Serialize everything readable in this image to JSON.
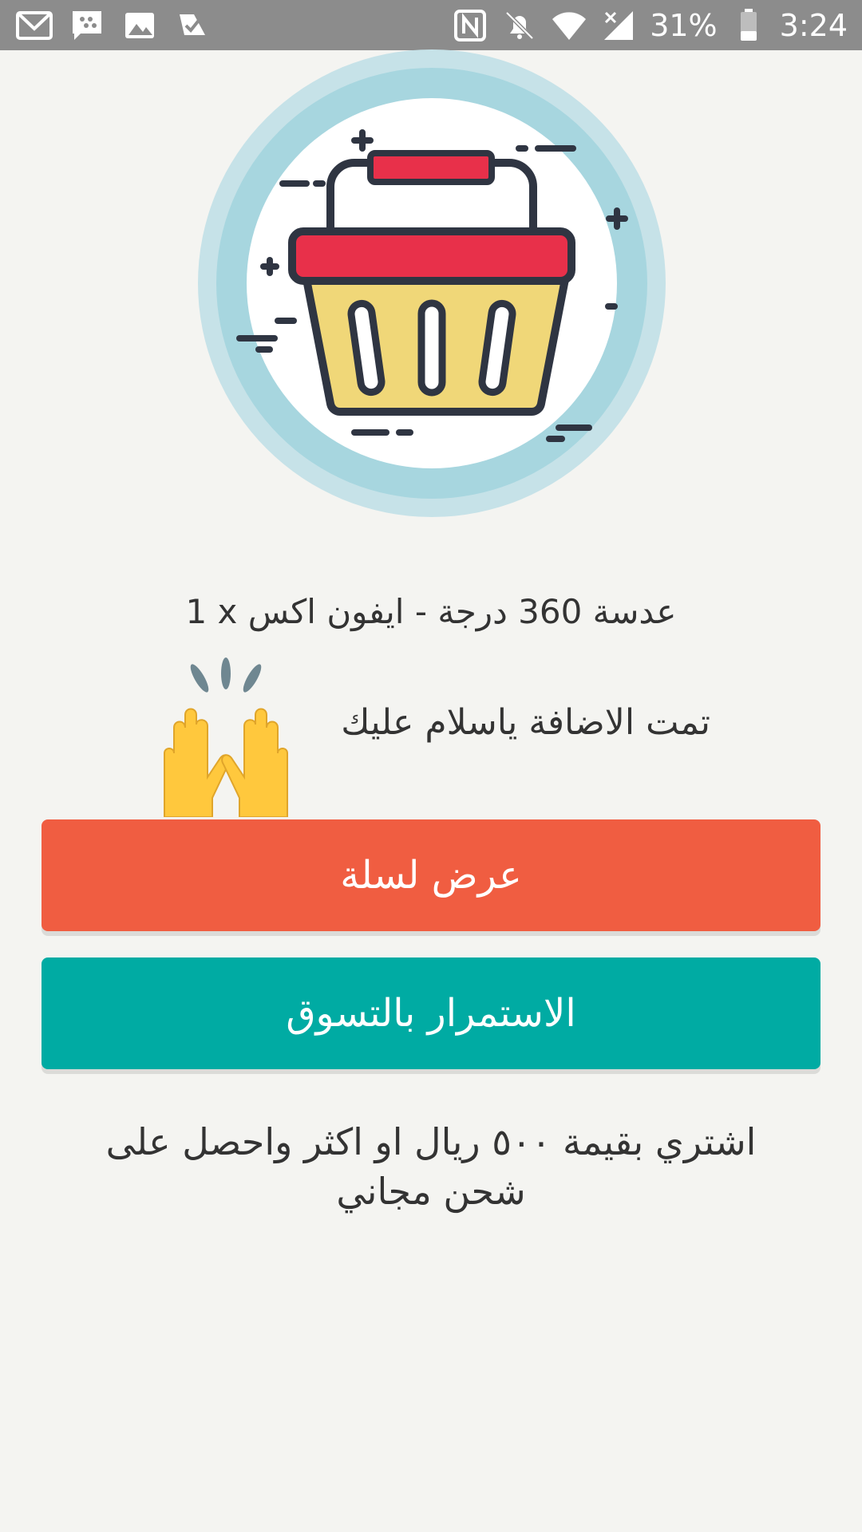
{
  "status_bar": {
    "battery": "31%",
    "time": "3:24",
    "left_icons": [
      "gmail-icon",
      "bbm-icon",
      "image-icon",
      "task-check-icon"
    ],
    "right_icons": [
      "nfc-icon",
      "bell-off-icon",
      "wifi-icon",
      "signal-off-icon",
      "battery-icon"
    ]
  },
  "hero": {
    "icon": "shopping-basket-icon"
  },
  "added_item": "1 x عدسة 360 درجة - ايفون اكس",
  "success": {
    "text": "تمت الاضافة ياسلام عليك",
    "emoji": "raising-hands-icon"
  },
  "buttons": {
    "view_cart": "عرض لسلة",
    "continue_shopping": "الاستمرار بالتسوق"
  },
  "promo": "اشتري بقيمة ٥٠٠ ريال او اكثر واحصل على شحن مجاني",
  "colors": {
    "status_bar": "#8c8c8c",
    "background": "#f4f4f1",
    "view_cart_button": "#f05d41",
    "continue_button": "#00aba3"
  }
}
